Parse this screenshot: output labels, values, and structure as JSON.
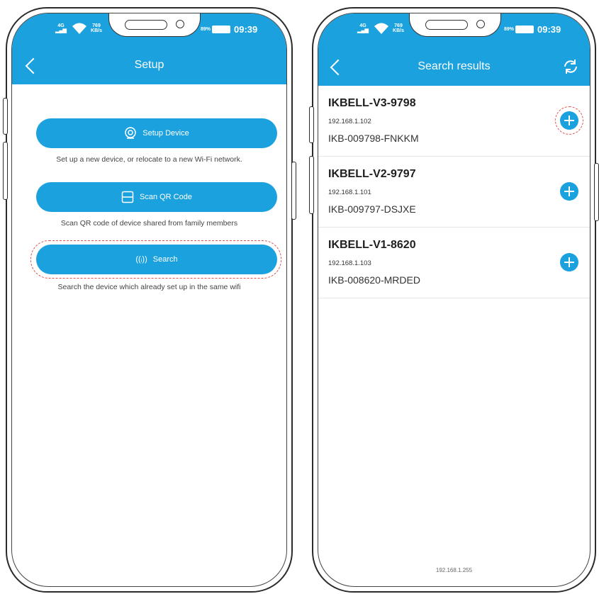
{
  "status_bar": {
    "signal": "4G",
    "speed_value": "769",
    "speed_unit": "KB/s",
    "battery": "89%",
    "time": "09:39"
  },
  "left_screen": {
    "title": "Setup",
    "buttons": [
      {
        "label": "Setup Device",
        "icon": "camera-icon",
        "caption": "Set up a new device, or relocate to a new Wi-Fi network."
      },
      {
        "label": "Scan QR Code",
        "icon": "qr-scan-icon",
        "caption": "Scan QR code of device shared from family members"
      },
      {
        "label": "Search",
        "icon": "wireless-signal-icon",
        "caption": "Search the device which already set up in the same wifi"
      }
    ]
  },
  "right_screen": {
    "title": "Search results",
    "devices": [
      {
        "name": "IKBELL-V3-9798",
        "ip": "192.168.1.102",
        "code": "IKB-009798-FNKKM"
      },
      {
        "name": "IKBELL-V2-9797",
        "ip": "192.168.1.101",
        "code": "IKB-009797-DSJXE"
      },
      {
        "name": "IKBELL-V1-8620",
        "ip": "192.168.1.103",
        "code": "IKB-008620-MRDED"
      }
    ],
    "footer": "192.168.1.255"
  },
  "colors": {
    "accent": "#1ba1de",
    "highlight": "#e0504f"
  }
}
